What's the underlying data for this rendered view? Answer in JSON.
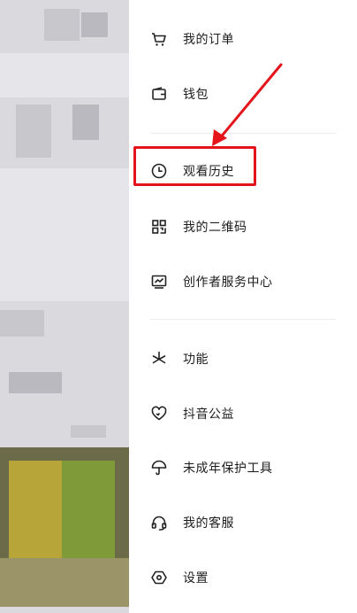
{
  "menu": {
    "items": [
      {
        "key": "orders",
        "label": "我的订单",
        "icon": "cart-icon"
      },
      {
        "key": "wallet",
        "label": "钱包",
        "icon": "wallet-icon"
      },
      {
        "key": "history",
        "label": "观看历史",
        "icon": "clock-icon"
      },
      {
        "key": "qrcode",
        "label": "我的二维码",
        "icon": "qrcode-icon"
      },
      {
        "key": "creator",
        "label": "创作者服务中心",
        "icon": "monitor-chart-icon"
      },
      {
        "key": "functions",
        "label": "功能",
        "icon": "asterisk-icon"
      },
      {
        "key": "charity",
        "label": "抖音公益",
        "icon": "heart-hands-icon"
      },
      {
        "key": "minor",
        "label": "未成年保护工具",
        "icon": "umbrella-icon"
      },
      {
        "key": "service",
        "label": "我的客服",
        "icon": "headset-icon"
      },
      {
        "key": "settings",
        "label": "设置",
        "icon": "hexagon-gear-icon"
      }
    ]
  },
  "annotation": {
    "highlight_color": "#e5141b",
    "target": "history"
  }
}
